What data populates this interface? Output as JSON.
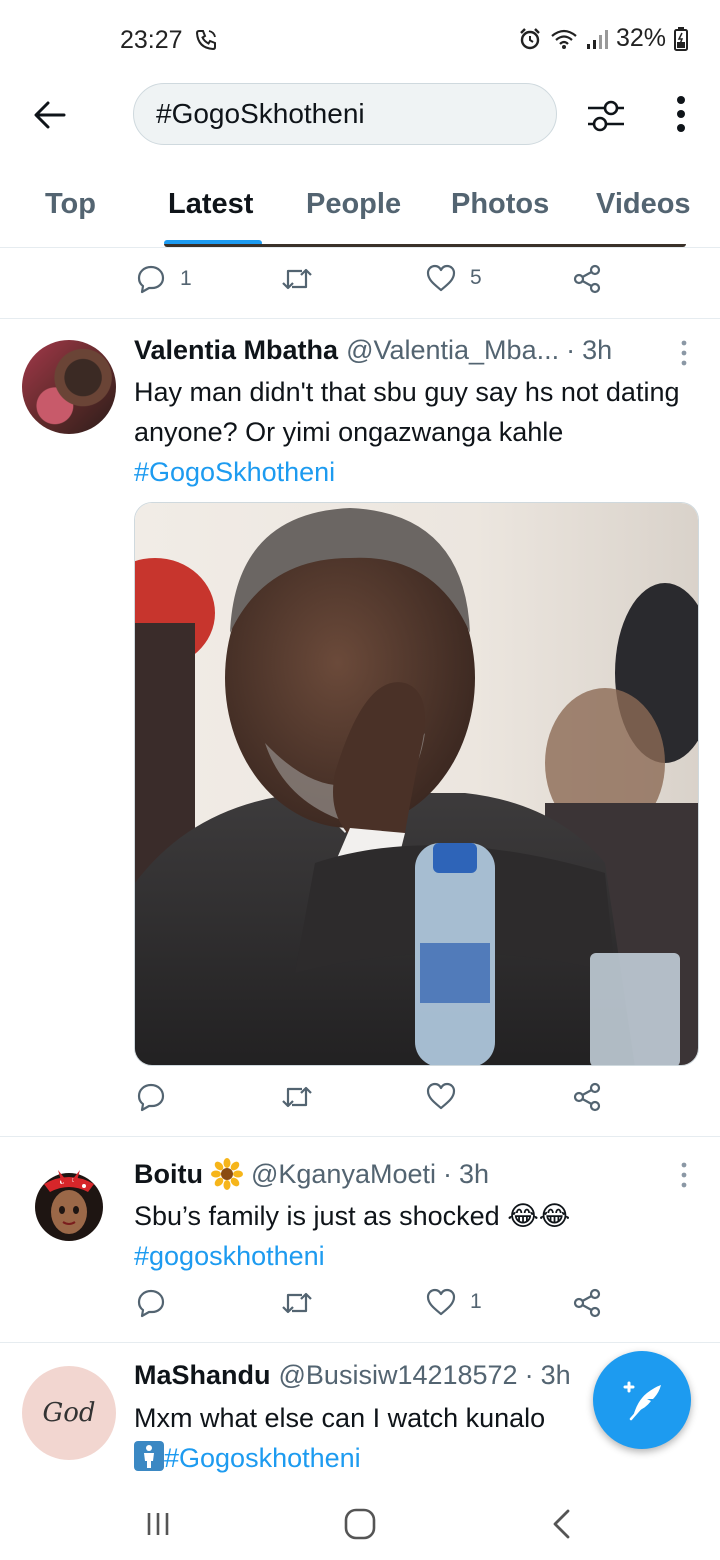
{
  "status_bar": {
    "time": "23:27",
    "battery": "32%"
  },
  "search": {
    "query": "#GogoSkhotheni"
  },
  "tabs": [
    {
      "label": "Top"
    },
    {
      "label": "Latest"
    },
    {
      "label": "People"
    },
    {
      "label": "Photos"
    },
    {
      "label": "Videos"
    }
  ],
  "active_tab": "Latest",
  "prev_tweet": {
    "replies": "1",
    "likes": "5"
  },
  "tweets": [
    {
      "name": "Valentia Mbatha",
      "handle": "@Valentia_Mba...",
      "time": "3h",
      "text": "Hay man didn't that sbu guy say hs not dating anyone? Or yimi ongazwanga kahle",
      "hashtag": "#GogoSkhotheni"
    },
    {
      "name": "Boitu",
      "handle": "@KganyaMoeti",
      "time": "3h",
      "text": "Sbu’s family is just as shocked",
      "emoji": "😂😂",
      "hashtag": "#gogoskhotheni",
      "likes": "1"
    },
    {
      "name": "MaShandu",
      "handle": "@Busisiw14218572",
      "time": "3h",
      "text": "Mxm what else can I watch kunalo",
      "hashtag": "#Gogoskhotheni",
      "avatar_text": "God"
    }
  ],
  "colors": {
    "accent": "#1d9bf0",
    "text": "#0f1419",
    "muted": "#536471"
  }
}
